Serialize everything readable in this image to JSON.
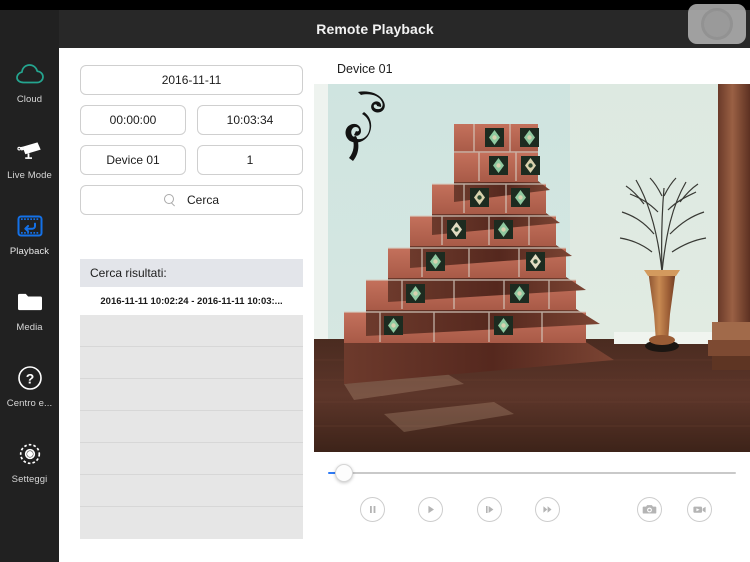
{
  "window": {
    "title": "Remote Playback",
    "float_button_icon": "circle-knob-icon"
  },
  "sidebar": {
    "items": [
      {
        "label": "Cloud",
        "icon": "cloud-icon",
        "active": false,
        "color": "#24a58f"
      },
      {
        "label": "Live Mode",
        "icon": "cctv-camera-icon",
        "active": false,
        "color": "#ffffff"
      },
      {
        "label": "Playback",
        "icon": "film-rewind-icon",
        "active": true,
        "color": "#1471e8"
      },
      {
        "label": "Media",
        "icon": "folder-icon",
        "active": false,
        "color": "#ffffff"
      },
      {
        "label": "Centro e...",
        "icon": "question-circle-icon",
        "active": false,
        "color": "#ffffff"
      },
      {
        "label": "Setteggi",
        "icon": "gear-icon",
        "active": false,
        "color": "#ffffff"
      }
    ]
  },
  "search_form": {
    "date": "2016-11-11",
    "start_time": "00:00:00",
    "end_time": "10:03:34",
    "device": "Device 01",
    "channel": "1",
    "search_button_label": "Cerca",
    "search_icon": "magnifier-icon"
  },
  "results": {
    "header": "Cerca risultati:",
    "rows": [
      "2016-11-11 10:02:24 - 2016-11-11 10:03:..."
    ],
    "empty_row_count": 7
  },
  "player": {
    "device_label": "Device 01",
    "timeline": {
      "position_percent": 0,
      "fill_color": "#2f7bf6"
    },
    "controls": [
      {
        "name": "pause-button",
        "icon": "pause-icon"
      },
      {
        "name": "play-button",
        "icon": "play-icon"
      },
      {
        "name": "step-forward-button",
        "icon": "step-forward-icon"
      },
      {
        "name": "fast-forward-button",
        "icon": "fast-forward-icon"
      },
      {
        "name": "snapshot-button",
        "icon": "camera-icon"
      },
      {
        "name": "record-button",
        "icon": "camcorder-icon"
      }
    ]
  },
  "theme": {
    "sidebar_bg": "#212121",
    "titlebar_bg": "#282828",
    "accent": "#1471e8",
    "results_header_bg": "#e3e5ea",
    "empty_row_bg": "#e6e6e6"
  }
}
